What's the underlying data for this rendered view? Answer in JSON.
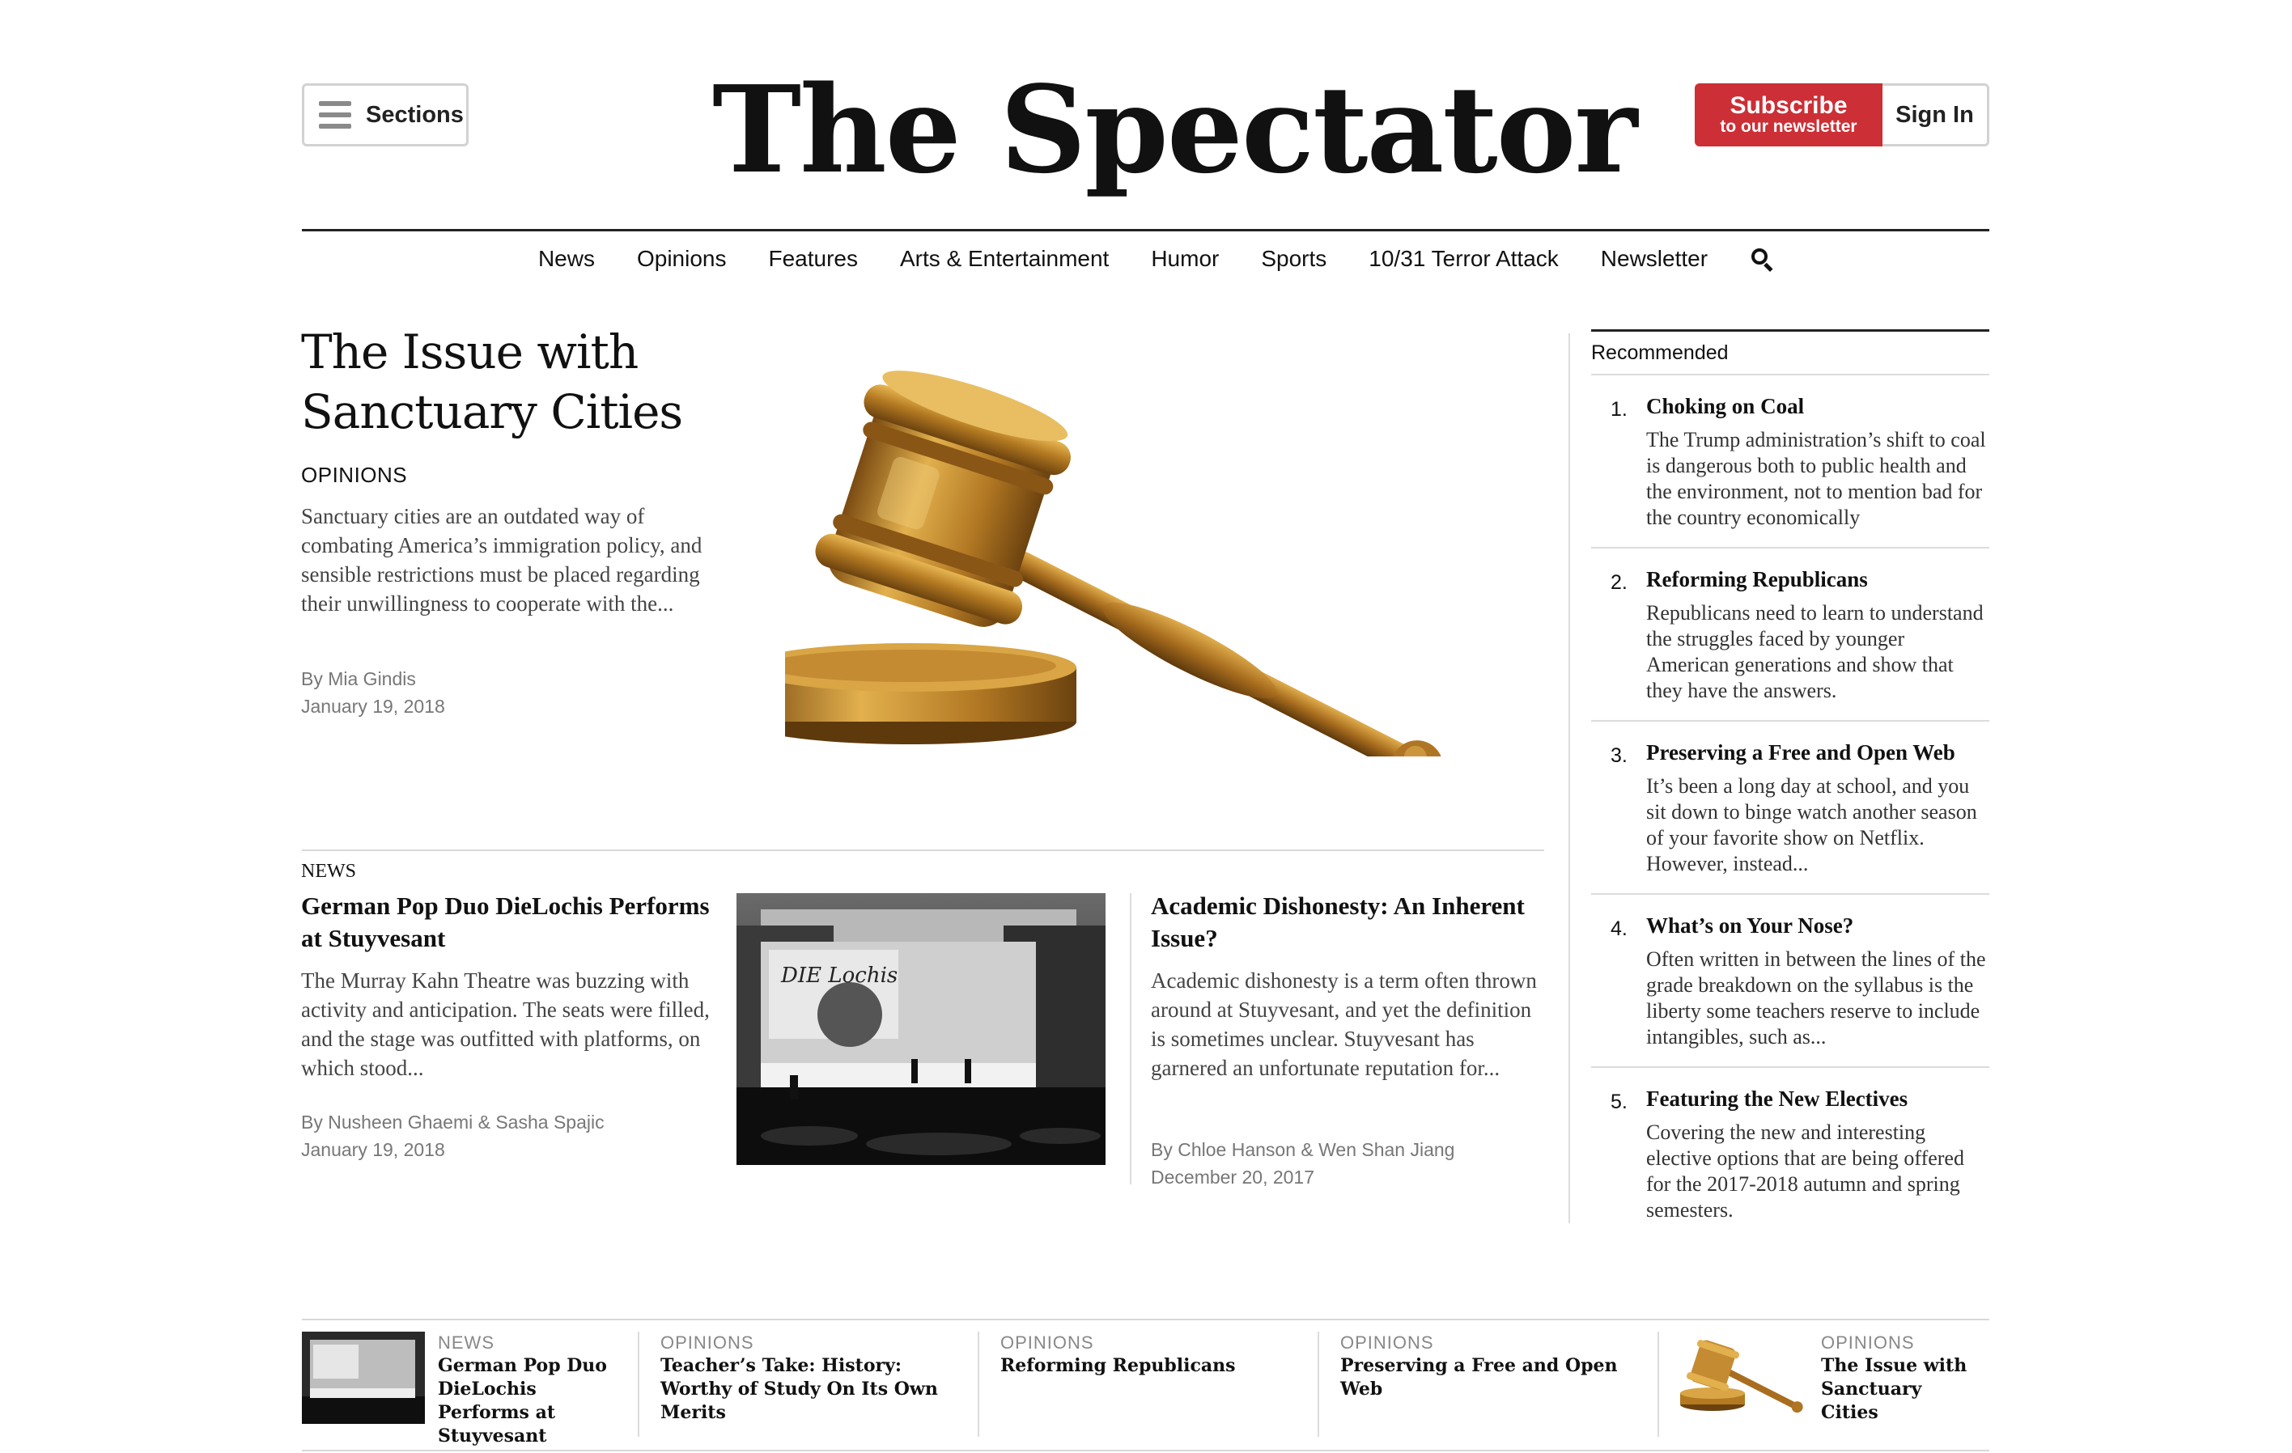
{
  "header": {
    "sections_label": "Sections",
    "masthead": "The Spectator",
    "subscribe_main": "Subscribe",
    "subscribe_sub": "to our newsletter",
    "signin_label": "Sign In",
    "accent_color": "#cc2f36"
  },
  "nav": {
    "items": [
      "News",
      "Opinions",
      "Features",
      "Arts & Entertainment",
      "Humor",
      "Sports",
      "10/31 Terror Attack",
      "Newsletter"
    ],
    "search_icon": "search-icon"
  },
  "lead": {
    "title": "The Issue with Sanctuary Cities",
    "section": "OPINIONS",
    "summary": "Sanctuary cities are an outdated way of combating America’s immigration policy, and sensible restrictions must be placed regarding their unwillingness to cooperate with the...",
    "byline": "By Mia Gindis",
    "date": "January 19, 2018",
    "image": "gavel-image"
  },
  "story2": {
    "section": "NEWS",
    "title": "German Pop Duo DieLochis Performs at Stuyvesant",
    "summary": "The Murray Kahn Theatre was buzzing with activity and anticipation. The seats were filled, and the stage was outfitted with platforms, on which stood...",
    "byline": "By Nusheen Ghaemi & Sasha Spajic",
    "date": "January 19, 2018",
    "photo_banner_text": "DIE Lochis"
  },
  "story3": {
    "title": "Academic Dishonesty: An Inherent Issue?",
    "summary": "Academic dishonesty is a term often thrown around at Stuyvesant, and yet the definition is sometimes unclear. Stuyvesant has garnered an unfortunate reputation for...",
    "byline": "By Chloe Hanson & Wen Shan Jiang",
    "date": "December 20, 2017"
  },
  "recommended": {
    "header": "Recommended",
    "items": [
      {
        "num": "1.",
        "title": "Choking on Coal",
        "desc": "The Trump administration’s shift to coal is dangerous both to public health and the environment, not to mention bad for the country economically"
      },
      {
        "num": "2.",
        "title": "Reforming Republicans",
        "desc": "Republicans need to learn to understand the struggles faced by younger American generations and show that they have the answers."
      },
      {
        "num": "3.",
        "title": "Preserving a Free and Open Web",
        "desc": "It’s been a long day at school, and you sit down to binge watch another season of your favorite show on Netflix. However, instead..."
      },
      {
        "num": "4.",
        "title": "What’s on Your Nose?",
        "desc": "Often written in between the lines of the grade breakdown on the syllabus is the liberty some teachers reserve to include intangibles, such as..."
      },
      {
        "num": "5.",
        "title": "Featuring the New Electives",
        "desc": "Covering the new and interesting elective options that are being offered for the 2017-2018 autumn and spring semesters."
      }
    ]
  },
  "ticker": {
    "items": [
      {
        "section": "NEWS",
        "title": "German Pop Duo DieLochis Performs at Stuyvesant",
        "thumb": "concert-thumb"
      },
      {
        "section": "OPINIONS",
        "title": "Teacher’s Take: History: Worthy of Study On Its Own Merits",
        "thumb": ""
      },
      {
        "section": "OPINIONS",
        "title": "Reforming Republicans",
        "thumb": ""
      },
      {
        "section": "OPINIONS",
        "title": "Preserving a Free and Open Web",
        "thumb": ""
      },
      {
        "section": "OPINIONS",
        "title": "The Issue with Sanctuary Cities",
        "thumb": "gavel-thumb"
      }
    ]
  }
}
